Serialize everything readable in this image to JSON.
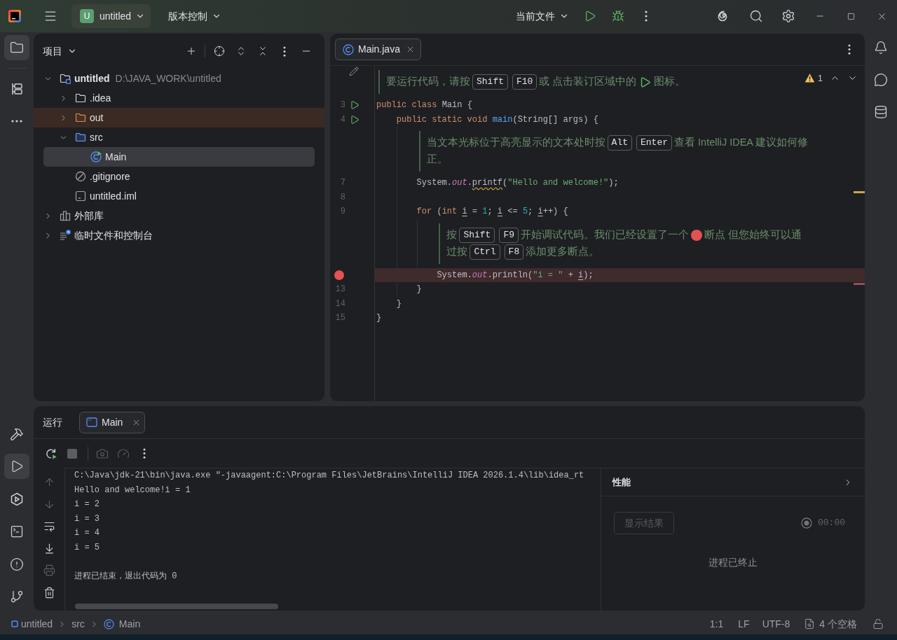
{
  "title_bar": {
    "project_widget": {
      "initial": "U",
      "name": "untitled"
    },
    "vcs_menu": {
      "label": "版本控制"
    },
    "run_config": {
      "label": "当前文件"
    }
  },
  "left_tool_strip": {
    "top": [
      {
        "kind": "project",
        "selected": true
      },
      {
        "kind": "structure",
        "selected": false
      },
      {
        "kind": "more",
        "selected": false
      }
    ],
    "bottom": [
      {
        "kind": "build",
        "selected": false
      },
      {
        "kind": "run",
        "selected": true
      },
      {
        "kind": "services",
        "selected": false
      },
      {
        "kind": "terminal",
        "selected": false
      },
      {
        "kind": "problems",
        "selected": false
      },
      {
        "kind": "git",
        "selected": false
      }
    ]
  },
  "project_panel": {
    "title": "项目",
    "tree": [
      {
        "name": "untitled",
        "path": "D:\\JAVA_WORK\\untitled",
        "kind": "module",
        "expanded": true,
        "selected": false,
        "children": [
          {
            "name": ".idea",
            "kind": "folder",
            "expanded": false,
            "selected": false
          },
          {
            "name": "out",
            "kind": "excluded_folder",
            "expanded": false,
            "selected": false
          },
          {
            "name": "src",
            "kind": "source_folder",
            "expanded": true,
            "selected": false,
            "children": [
              {
                "name": "Main",
                "kind": "java_class",
                "selected": true
              }
            ]
          },
          {
            "name": ".gitignore",
            "kind": "ignore_file",
            "selected": false
          },
          {
            "name": "untitled.iml",
            "kind": "iml_file",
            "selected": false
          }
        ]
      },
      {
        "name": "外部库",
        "kind": "libraries",
        "expanded": false,
        "selected": false
      },
      {
        "name": "临时文件和控制台",
        "kind": "scratches",
        "expanded": false,
        "selected": false
      }
    ]
  },
  "editor": {
    "tabs": [
      {
        "label": "Main.java",
        "selected": true
      }
    ],
    "inspections": {
      "warnings": "1"
    },
    "lines": [
      {
        "kind": "doc",
        "edit_toggle": true,
        "rows": [
          [
            {
              "kind": "text",
              "text": "要运行代码，请按"
            },
            {
              "kind": "key",
              "text": "Shift"
            },
            {
              "kind": "key",
              "text": "F10"
            },
            {
              "kind": "text",
              "text": "或 点击装订区域中的"
            },
            {
              "kind": "run_icon"
            },
            {
              "kind": "text",
              "text": "图标。"
            }
          ]
        ]
      },
      {
        "kind": "code",
        "number": "3",
        "runnable": true,
        "breakpoint": false,
        "warning": false,
        "tokens": [
          {
            "kind": "keyword",
            "text": "public class "
          },
          {
            "kind": "plain",
            "text": "Main {"
          }
        ]
      },
      {
        "kind": "code",
        "number": "4",
        "runnable": true,
        "breakpoint": false,
        "warning": false,
        "tokens": [
          {
            "kind": "keyword",
            "text": "    public static void "
          },
          {
            "kind": "method_decl",
            "text": "main"
          },
          {
            "kind": "plain",
            "text": "(String[] args) {"
          }
        ]
      },
      {
        "kind": "doc",
        "edit_toggle": false,
        "rows": [
          [
            {
              "kind": "text",
              "text": "当文本光标位于高亮显示的文本处时按"
            },
            {
              "kind": "key",
              "text": "Alt"
            },
            {
              "kind": "key",
              "text": "Enter"
            },
            {
              "kind": "text",
              "text": "查看 IntelliJ IDEA 建议如何修"
            }
          ],
          [
            {
              "kind": "text",
              "text": "正。"
            }
          ]
        ]
      },
      {
        "kind": "code",
        "number": "7",
        "runnable": false,
        "breakpoint": false,
        "warning": true,
        "tokens": [
          {
            "kind": "plain",
            "text": "        System."
          },
          {
            "kind": "static_field",
            "text": "out"
          },
          {
            "kind": "plain",
            "text": "."
          },
          {
            "kind": "warning",
            "text": "printf"
          },
          {
            "kind": "plain",
            "text": "("
          },
          {
            "kind": "string",
            "text": "\"Hello and welcome!\""
          },
          {
            "kind": "plain",
            "text": ");"
          }
        ]
      },
      {
        "kind": "code",
        "number": "8",
        "runnable": false,
        "breakpoint": false,
        "warning": false
      },
      {
        "kind": "code",
        "number": "9",
        "runnable": false,
        "breakpoint": false,
        "warning": false,
        "tokens": [
          {
            "kind": "keyword",
            "text": "        for"
          },
          {
            "kind": "plain",
            "text": " ("
          },
          {
            "kind": "keyword",
            "text": "int "
          },
          {
            "kind": "reassigned",
            "text": "i"
          },
          {
            "kind": "plain",
            "text": " = "
          },
          {
            "kind": "number",
            "text": "1"
          },
          {
            "kind": "plain",
            "text": "; "
          },
          {
            "kind": "reassigned",
            "text": "i"
          },
          {
            "kind": "plain",
            "text": " <= "
          },
          {
            "kind": "number",
            "text": "5"
          },
          {
            "kind": "plain",
            "text": "; "
          },
          {
            "kind": "reassigned",
            "text": "i"
          },
          {
            "kind": "plain",
            "text": "++) {"
          }
        ]
      },
      {
        "kind": "doc",
        "edit_toggle": false,
        "rows": [
          [
            {
              "kind": "text",
              "text": "按"
            },
            {
              "kind": "key",
              "text": "Shift"
            },
            {
              "kind": "key",
              "text": "F9"
            },
            {
              "kind": "text",
              "text": "开始调试代码。我们已经设置了一个"
            },
            {
              "kind": "breakpoint_icon"
            },
            {
              "kind": "text",
              "text": "断点 但您始终可以通"
            }
          ],
          [
            {
              "kind": "text",
              "text": "过按"
            },
            {
              "kind": "key",
              "text": "Ctrl"
            },
            {
              "kind": "key",
              "text": "F8"
            },
            {
              "kind": "text",
              "text": "添加更多断点。"
            }
          ]
        ]
      },
      {
        "kind": "code",
        "runnable": false,
        "breakpoint": true,
        "warning": false,
        "tokens": [
          {
            "kind": "plain",
            "text": "            System."
          },
          {
            "kind": "static_field",
            "text": "out"
          },
          {
            "kind": "plain",
            "text": ".println("
          },
          {
            "kind": "string",
            "text": "\"i = \""
          },
          {
            "kind": "plain",
            "text": " + "
          },
          {
            "kind": "reassigned",
            "text": "i"
          },
          {
            "kind": "plain",
            "text": ");"
          }
        ]
      },
      {
        "kind": "code",
        "number": "13",
        "runnable": false,
        "breakpoint": false,
        "warning": false,
        "tokens": [
          {
            "kind": "plain",
            "text": "        }"
          }
        ]
      },
      {
        "kind": "code",
        "number": "14",
        "runnable": false,
        "breakpoint": false,
        "warning": false,
        "tokens": [
          {
            "kind": "plain",
            "text": "    }"
          }
        ]
      },
      {
        "kind": "code",
        "number": "15",
        "runnable": false,
        "breakpoint": false,
        "warning": false,
        "tokens": [
          {
            "kind": "plain",
            "text": "}"
          }
        ]
      }
    ]
  },
  "run_panel": {
    "title": "运行",
    "tabs": [
      {
        "label": "Main",
        "selected": true
      }
    ],
    "actions": [
      {
        "kind": "rerun",
        "disabled": false
      },
      {
        "kind": "stop",
        "disabled": true
      },
      {
        "kind": "snapshot",
        "disabled": true
      },
      {
        "kind": "profiler",
        "disabled": true
      },
      {
        "kind": "more",
        "disabled": false
      }
    ],
    "side_actions": [
      {
        "kind": "up",
        "disabled": true
      },
      {
        "kind": "down",
        "disabled": true
      },
      {
        "kind": "soft_wrap",
        "disabled": false
      },
      {
        "kind": "scroll_end",
        "disabled": false
      },
      {
        "kind": "print",
        "disabled": true
      },
      {
        "kind": "clear",
        "disabled": false
      }
    ],
    "console": [
      {
        "kind": "command",
        "text": "C:\\Java\\jdk-21\\bin\\java.exe \"-javaagent:C:\\Program Files\\JetBrains\\IntelliJ IDEA 2026.1.4\\lib\\idea_rt"
      },
      {
        "kind": "output",
        "text": "Hello and welcome!i = 1"
      },
      {
        "kind": "output",
        "text": "i = 2"
      },
      {
        "kind": "output",
        "text": "i = 3"
      },
      {
        "kind": "output",
        "text": "i = 4"
      },
      {
        "kind": "output",
        "text": "i = 5"
      },
      {
        "kind": "exit",
        "text": "进程已结束，退出代码为 0"
      }
    ],
    "profiler": {
      "title": "性能",
      "button": {
        "label": "显示结果",
        "disabled": true
      },
      "timer": "00:00",
      "status": "进程已终止"
    }
  },
  "status_bar": {
    "breadcrumbs": [
      {
        "label": "untitled",
        "kind": "module"
      },
      {
        "label": "src",
        "kind": "folder"
      },
      {
        "label": "Main",
        "kind": "class"
      }
    ],
    "position": "1:1",
    "line_separator": "LF",
    "encoding": "UTF-8",
    "indent": "4 个空格"
  }
}
